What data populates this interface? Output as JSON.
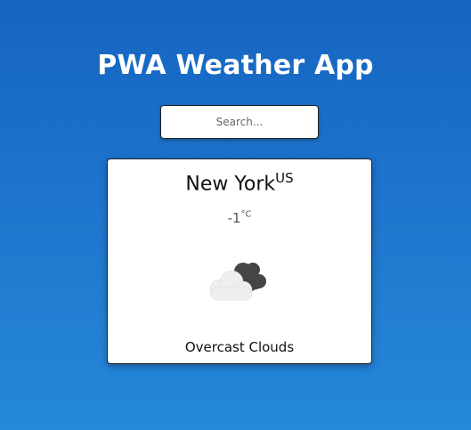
{
  "header": {
    "title": "PWA Weather App"
  },
  "search": {
    "placeholder": "Search...",
    "value": ""
  },
  "weather": {
    "city": "New York",
    "country": "US",
    "temperature": "-1",
    "unit": "°C",
    "description": "Overcast Clouds",
    "icon": "overcast-clouds-icon"
  },
  "colors": {
    "background_top": "#1565c0",
    "background_bottom": "#2588da",
    "card": "#ffffff",
    "title_text": "#ffffff",
    "cloud_dark": "#444444",
    "cloud_light": "#f0f0f0"
  }
}
